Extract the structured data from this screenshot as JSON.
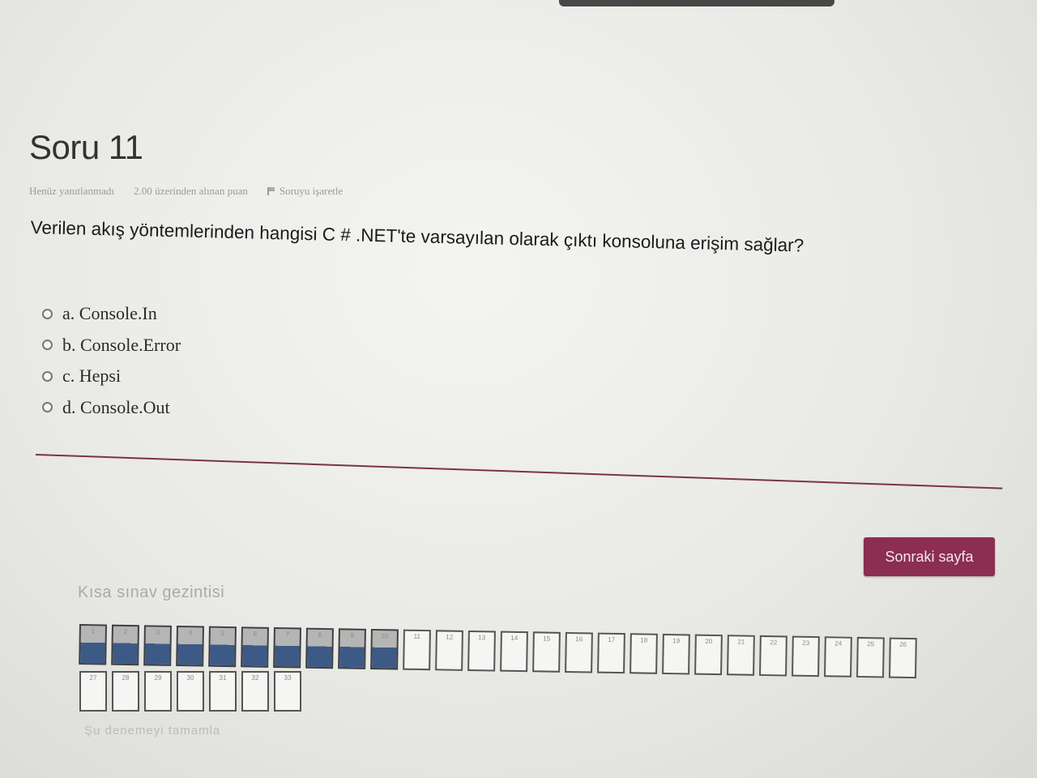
{
  "question": {
    "title": "Soru 11",
    "status": "Henüz yanıtlanmadı",
    "points": "2.00 üzerinden alınan puan",
    "flag_label": "Soruyu işaretle",
    "text": "Verilen akış yöntemlerinden hangisi C # .NET'te varsayılan olarak çıktı konsoluna erişim sağlar?",
    "answers": [
      {
        "label": "a. Console.In"
      },
      {
        "label": "b. Console.Error"
      },
      {
        "label": "c. Hepsi"
      },
      {
        "label": "d. Console.Out"
      }
    ]
  },
  "next_button": "Sonraki sayfa",
  "navigation": {
    "title": "Kısa sınav gezintisi",
    "row1_numbers": [
      "1",
      "2",
      "3",
      "4",
      "5",
      "6",
      "7",
      "8",
      "9",
      "10",
      "11",
      "12",
      "13",
      "14",
      "15",
      "16",
      "17",
      "18",
      "19",
      "20",
      "21",
      "22",
      "23",
      "24",
      "25",
      "26"
    ],
    "row2_numbers": [
      "27",
      "28",
      "29",
      "30",
      "31",
      "32",
      "33"
    ],
    "answered_count": 10
  },
  "finish_link": "Şu denemeyi tamamla"
}
